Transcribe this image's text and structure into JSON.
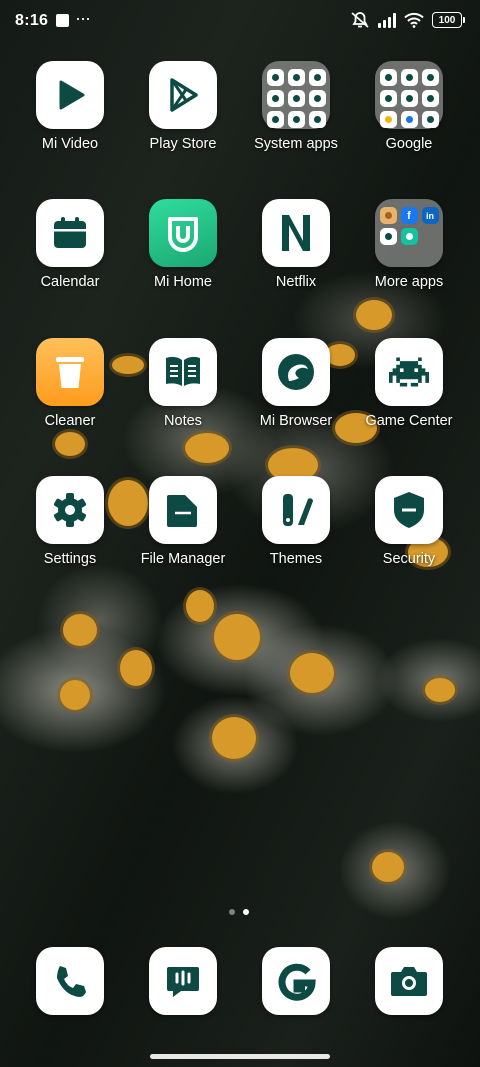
{
  "status_bar": {
    "time": "8:16",
    "notification_icons": [
      "screenshot-icon",
      "more-dots-icon"
    ],
    "system_icons": [
      "alarm-off-icon",
      "signal-icon",
      "wifi-icon",
      "battery-icon"
    ],
    "battery_level": "100"
  },
  "apps": [
    {
      "label": "Mi Video",
      "icon": "play-icon"
    },
    {
      "label": "Play Store",
      "icon": "play-store-icon"
    },
    {
      "label": "System apps",
      "icon": "folder-icon"
    },
    {
      "label": "Google",
      "icon": "folder-icon"
    },
    {
      "label": "Calendar",
      "icon": "calendar-icon"
    },
    {
      "label": "Mi Home",
      "icon": "mi-home-icon"
    },
    {
      "label": "Netflix",
      "icon": "netflix-n-icon"
    },
    {
      "label": "More apps",
      "icon": "folder-icon"
    },
    {
      "label": "Cleaner",
      "icon": "trash-icon"
    },
    {
      "label": "Notes",
      "icon": "open-book-icon"
    },
    {
      "label": "Mi Browser",
      "icon": "browser-icon"
    },
    {
      "label": "Game Center",
      "icon": "space-invader-icon"
    },
    {
      "label": "Settings",
      "icon": "gear-icon"
    },
    {
      "label": "File Manager",
      "icon": "folder-file-icon"
    },
    {
      "label": "Themes",
      "icon": "themes-brush-icon"
    },
    {
      "label": "Security",
      "icon": "shield-icon"
    }
  ],
  "page_indicator": {
    "pages": 2,
    "active": 2
  },
  "dock": [
    {
      "icon": "phone-icon"
    },
    {
      "icon": "messages-icon"
    },
    {
      "icon": "google-g-icon"
    },
    {
      "icon": "camera-icon"
    }
  ],
  "colors": {
    "icon_dark": "#0d4a43",
    "mi_home_green": "#22c58a",
    "cleaner_orange": "#ffa92e"
  }
}
